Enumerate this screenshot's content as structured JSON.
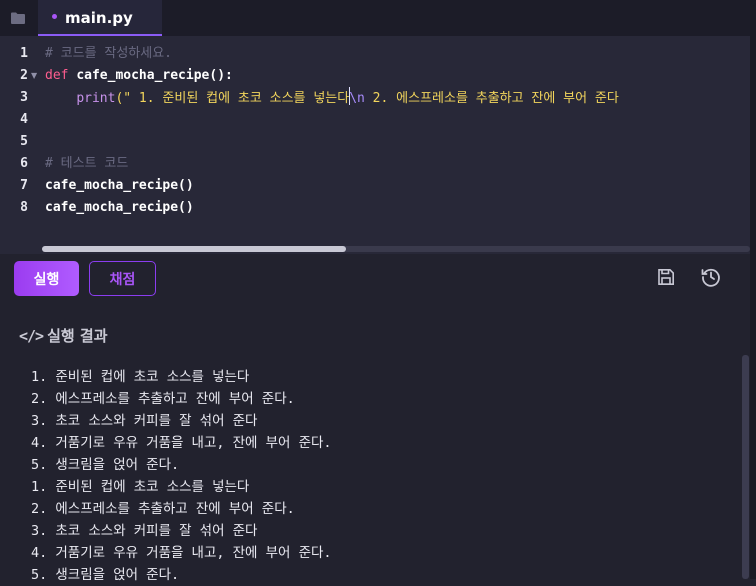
{
  "tabs": [
    {
      "label": "main.py",
      "active": true
    }
  ],
  "editor": {
    "line_numbers": [
      "1",
      "2",
      "3",
      "4",
      "5",
      "6",
      "7",
      "8"
    ],
    "line1": {
      "comment": "# 코드를 작성하세요."
    },
    "line2": {
      "keyword": "def ",
      "name": "cafe_mocha_recipe():"
    },
    "line3": {
      "indent": "    ",
      "builtin": "print",
      "paren": "(",
      "string_a": "\" 1. 준비된 컵에 초코 소스를 넣는다",
      "escape": "\\n",
      "string_b": " 2. 에스프레소를 추출하고 잔에 부어 준다"
    },
    "line6": {
      "comment": "# 테스트 코드"
    },
    "line7": {
      "call": "cafe_mocha_recipe()"
    },
    "line8": {
      "call": "cafe_mocha_recipe()"
    },
    "horizontal_scroll_position": 0
  },
  "toolbar": {
    "run_label": "실행",
    "grade_label": "채점",
    "save_icon": "save-icon",
    "history_icon": "history-icon"
  },
  "result": {
    "title_icon": "code-icon",
    "title": "실행 결과",
    "lines": [
      "1. 준비된 컵에 초코 소스를 넣는다",
      "2. 에스프레소를 추출하고 잔에 부어 준다.",
      "3. 초코 소스와 커피를 잘 섞어 준다",
      "4. 거품기로 우유 거품을 내고, 잔에 부어 준다.",
      "5. 생크림을 얹어 준다.",
      "1. 준비된 컵에 초코 소스를 넣는다",
      "2. 에스프레소를 추출하고 잔에 부어 준다.",
      "3. 초코 소스와 커피를 잘 섞어 준다",
      "4. 거품기로 우유 거품을 내고, 잔에 부어 준다.",
      "5. 생크림을 얹어 준다."
    ]
  },
  "colors": {
    "accent": "#9b3cf0",
    "keyword": "#ff5d8f",
    "string": "#f2d55c",
    "comment": "#6a6a82",
    "background": "#22222e"
  }
}
